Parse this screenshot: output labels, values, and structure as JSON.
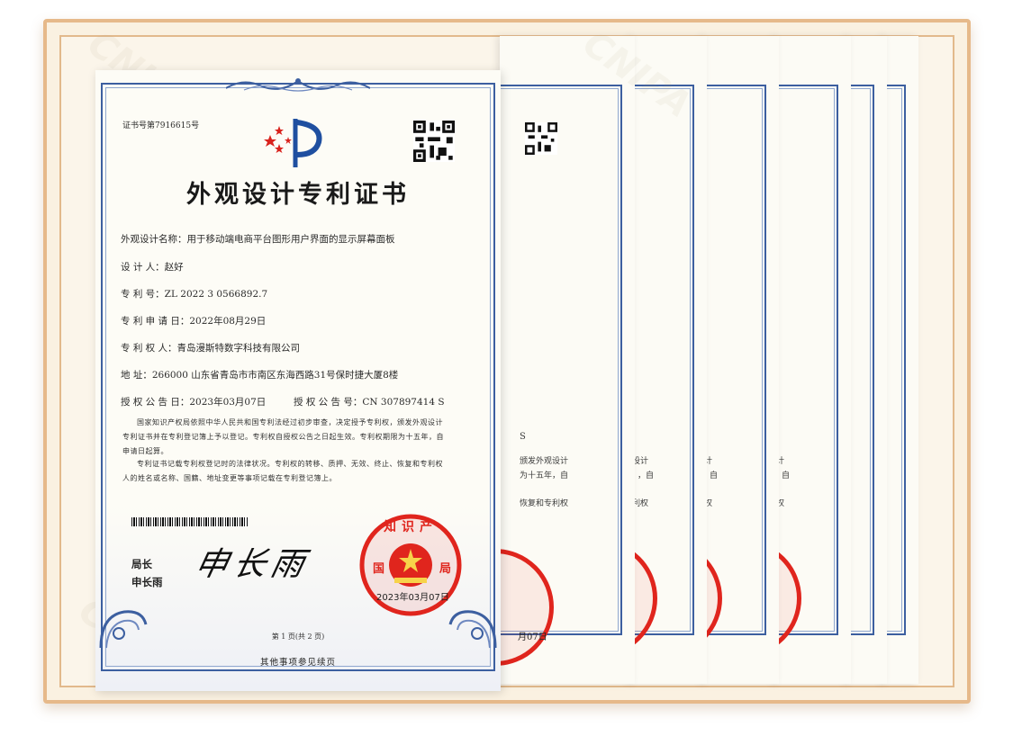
{
  "certificate": {
    "cert_no": "证书号第7916615号",
    "title": "外观设计专利证书",
    "fields": {
      "design_name": "外观设计名称：用于移动端电商平台图形用户界面的显示屏幕面板",
      "designer": "设    计    人：赵好",
      "patent_no": "专    利    号：ZL 2022 3 0566892.7",
      "apply_date": "专 利 申 请 日：2022年08月29日",
      "patentee": "专 利 权 人：青岛漫斯特数字科技有限公司",
      "address": "地          址：266000 山东省青岛市市南区东海西路31号保时捷大厦8楼",
      "grant_date": "授 权 公 告 日：2023年03月07日",
      "grant_no": "授 权 公 告 号：CN 307897414 S"
    },
    "paragraph1_lines": [
      "国家知识产权局依照中华人民共和国专利法经过初步审查，决定授予专利权，颁发外观设计",
      "专利证书并在专利登记簿上予以登记。专利权自授权公告之日起生效。专利权期限为十五年，自",
      "申请日起算。"
    ],
    "paragraph2_lines": [
      "专利证书记载专利权登记时的法律状况。专利权的转移、质押、无效、终止、恢复和专利权",
      "人的姓名或名称、国籍、地址变更等事项记载在专利登记簿上。"
    ],
    "director_title": "局长",
    "director_name": "申长雨",
    "signature": "申长雨",
    "seal_text": "国家知识产权局",
    "seal_date": "2023年03月07日",
    "page_info": "第 1 页(共 2 页)",
    "footer_note": "其他事项参见续页"
  },
  "back_sheets": [
    {
      "fragments": [
        "S",
        "颁发外观设计",
        "为十五年，自",
        "恢复和专利权"
      ],
      "stamp_date": "月07日"
    },
    {
      "fragments": [
        "设计",
        "，自",
        "利权"
      ]
    },
    {
      "fragments": [
        "计",
        "自",
        "权"
      ]
    },
    {
      "fragments": [
        "计",
        "自",
        "权"
      ]
    }
  ],
  "watermark": "CNIPA",
  "colors": {
    "frame": "#e6b98a",
    "border_blue": "#3c5fa0",
    "seal_red": "#e0251d"
  }
}
